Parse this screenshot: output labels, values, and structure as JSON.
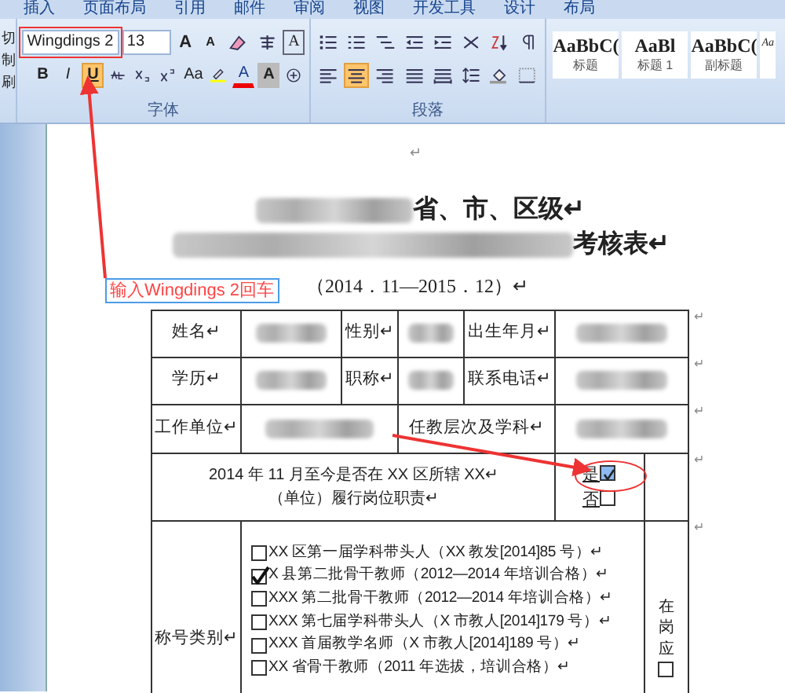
{
  "ribbon_tabs": [
    {
      "label": "插入"
    },
    {
      "label": "页面布局"
    },
    {
      "label": "引用"
    },
    {
      "label": "邮件"
    },
    {
      "label": "审阅"
    },
    {
      "label": "视图"
    },
    {
      "label": "开发工具"
    },
    {
      "label": "设计"
    },
    {
      "label": "布局"
    }
  ],
  "clipboard_group": {
    "items": [
      "切",
      "制",
      "刷"
    ]
  },
  "font_group": {
    "label": "字体",
    "font_name": "Wingdings 2",
    "font_size": "13",
    "row_1": [
      {
        "kind": "grow",
        "label": "A",
        "active": false
      },
      {
        "kind": "shrink",
        "label": "A",
        "active": false
      },
      {
        "kind": "icon",
        "active": false
      },
      {
        "kind": "icon",
        "active": false
      },
      {
        "kind": "boxed",
        "label": "A",
        "active": false
      }
    ],
    "row_2": [
      {
        "kind": "text",
        "label": "B",
        "active": false
      },
      {
        "kind": "italic",
        "label": "I",
        "active": false
      },
      {
        "kind": "underline",
        "label": "U",
        "active": true
      },
      {
        "kind": "icon",
        "active": false
      },
      {
        "kind": "icon",
        "active": false
      },
      {
        "kind": "icon",
        "active": false
      },
      {
        "kind": "text",
        "label": "Aa",
        "active": false
      },
      {
        "kind": "icon",
        "active": false
      },
      {
        "kind": "color",
        "label": "A",
        "active": false
      },
      {
        "kind": "shaded",
        "label": "A",
        "active": false
      },
      {
        "kind": "icon",
        "active": false
      }
    ]
  },
  "paragraph_group": {
    "label": "段落",
    "row_1": [
      {
        "kind": "icon",
        "active": false
      },
      {
        "kind": "icon",
        "active": false
      },
      {
        "kind": "icon",
        "active": false
      },
      {
        "kind": "icon",
        "active": false
      },
      {
        "kind": "icon",
        "active": false
      },
      {
        "kind": "icon",
        "active": false
      },
      {
        "kind": "icon",
        "active": false
      },
      {
        "kind": "icon",
        "active": false
      }
    ],
    "row_2": [
      {
        "kind": "icon",
        "active": false
      },
      {
        "kind": "icon",
        "active": true
      },
      {
        "kind": "icon",
        "active": false
      },
      {
        "kind": "icon",
        "active": false
      },
      {
        "kind": "icon",
        "active": false
      },
      {
        "kind": "icon",
        "active": false
      },
      {
        "kind": "icon",
        "active": false
      },
      {
        "kind": "icon",
        "active": false
      }
    ]
  },
  "styles": [
    {
      "preview": "AaBbC(",
      "name": "标题"
    },
    {
      "preview": "AaBl",
      "name": "标题 1"
    },
    {
      "preview": "AaBbC(",
      "name": "副标题"
    },
    {
      "preview": "Aa"
    }
  ],
  "document": {
    "top_mark": "↵",
    "title_line_1": "省、市、区级↵",
    "title_line_2": "考核表↵",
    "period": "（2014．11—2015．12）↵",
    "table": {
      "rows": [
        {
          "cells": [
            {
              "kind": "label",
              "text": "姓名↵"
            },
            {
              "kind": "blurred"
            },
            {
              "kind": "label",
              "text": "性别↵"
            },
            {
              "kind": "blurred"
            },
            {
              "kind": "label",
              "text": "出生年月↵"
            },
            {
              "kind": "blurred"
            }
          ],
          "end_mark": "↵"
        },
        {
          "cells": [
            {
              "kind": "label",
              "text": "学历↵"
            },
            {
              "kind": "blurred"
            },
            {
              "kind": "label",
              "text": "职称↵"
            },
            {
              "kind": "blurred"
            },
            {
              "kind": "label",
              "text": "联系电话↵"
            },
            {
              "kind": "blurred"
            }
          ],
          "end_mark": "↵"
        },
        {
          "cells": [
            {
              "kind": "label",
              "text": "工作单位↵"
            },
            {
              "kind": "blurred",
              "colspan": 2
            },
            {
              "kind": "label",
              "text": "任教层次及学科↵",
              "colspan": 2
            },
            {
              "kind": "blurred",
              "colspan": 2
            }
          ],
          "end_mark": "↵"
        }
      ],
      "question": {
        "lines": [
          "2014 年 11 月至今是否在 XX 区所辖 XX↵",
          "（单位）履行岗位职责↵"
        ],
        "options": [
          {
            "label": "是",
            "checked": true,
            "highlighted": true
          },
          {
            "label": "否",
            "checked": false,
            "highlighted": false
          }
        ],
        "end_mark": "↵"
      },
      "honors": {
        "label": "称号类别↵",
        "items": [
          {
            "text": "XX 区第一届学科带头人（XX 教发[2014]85 号）↵",
            "checked": false
          },
          {
            "text": "X 县第二批骨干教师（2012—2014 年培训合格）↵",
            "checked": true
          },
          {
            "text": "XXX 第二批骨干教师（2012—2014 年培训合格）↵",
            "checked": false
          },
          {
            "text": "XXX 第七届学科带头人（X 市教人[2014]179 号）↵",
            "checked": false
          },
          {
            "text": "XXX 首届教学名师（X 市教人[2014]189 号）↵",
            "checked": false
          },
          {
            "text": "XX 省骨干教师（2011 年选拔，培训合格）↵",
            "checked": false
          }
        ],
        "side_text": "在岗应",
        "side_checked": false,
        "end_mark": "↵"
      }
    }
  },
  "annotation": {
    "label": "输入Wingdings 2回车"
  }
}
